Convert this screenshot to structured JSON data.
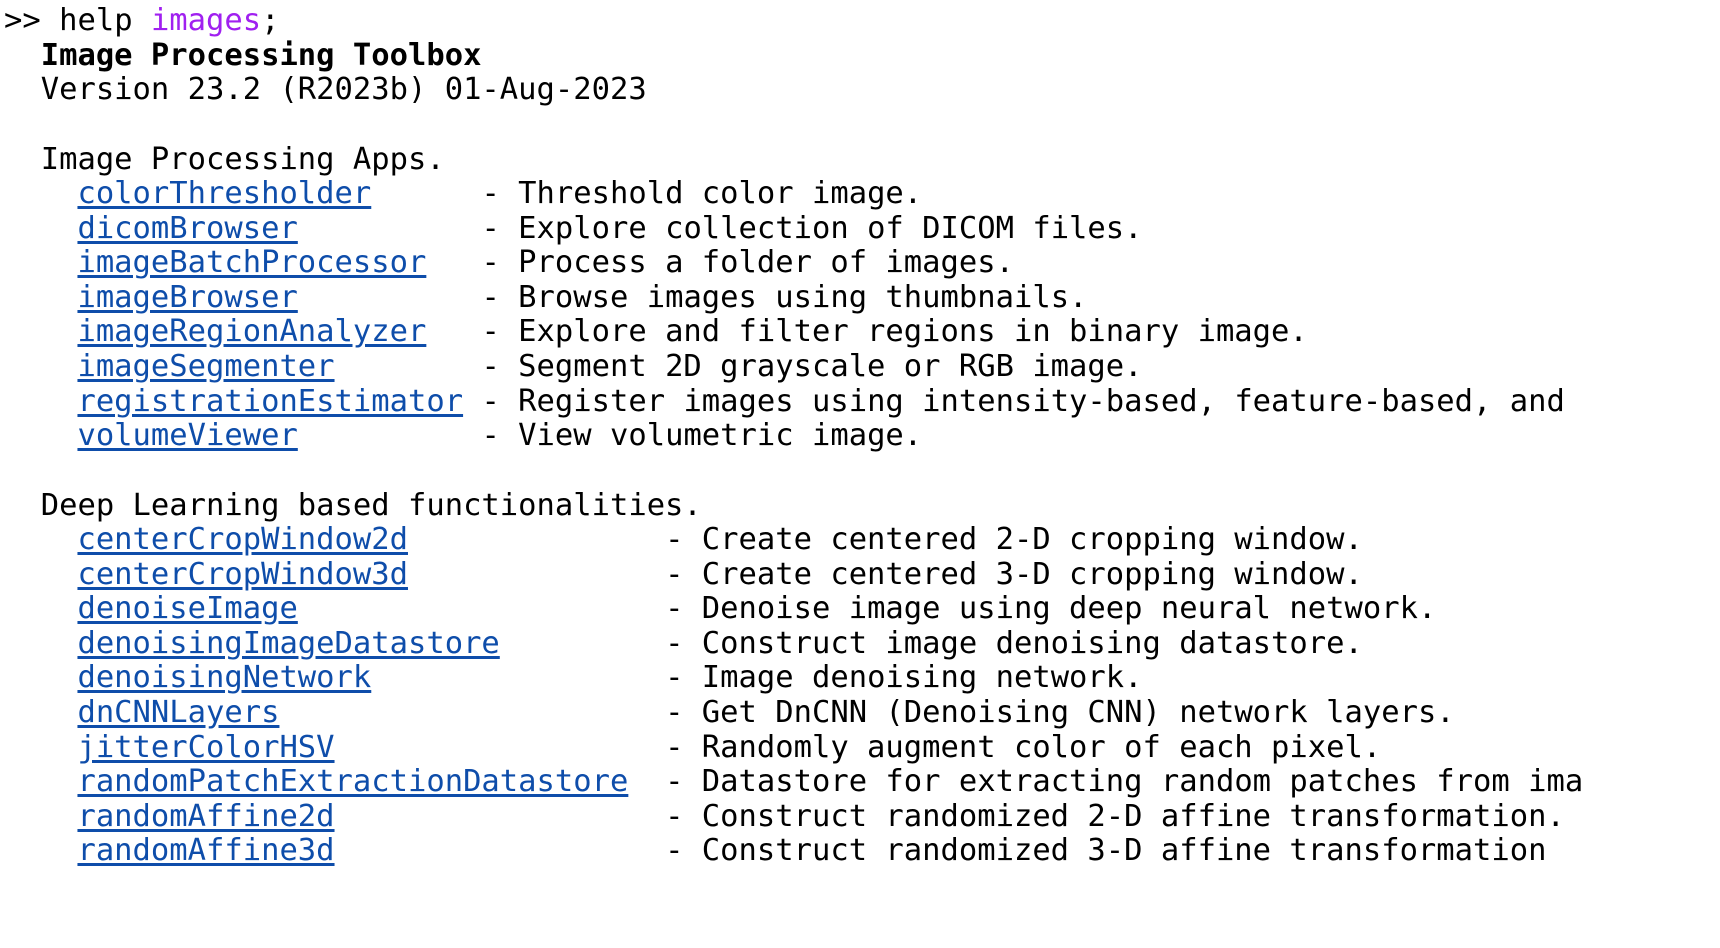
{
  "command": {
    "prompt": ">>",
    "verb": "help",
    "argument": "images",
    "terminator": ";"
  },
  "toolbox": {
    "name": "Image Processing Toolbox",
    "version": "Version 23.2 (R2023b) 01-Aug-2023"
  },
  "sections": [
    {
      "heading": "Image Processing Apps.",
      "items": [
        {
          "name": "colorThresholder",
          "desc": "- Threshold color image."
        },
        {
          "name": "dicomBrowser",
          "desc": "- Explore collection of DICOM files."
        },
        {
          "name": "imageBatchProcessor",
          "desc": "- Process a folder of images."
        },
        {
          "name": "imageBrowser",
          "desc": "- Browse images using thumbnails."
        },
        {
          "name": "imageRegionAnalyzer",
          "desc": "- Explore and filter regions in binary image."
        },
        {
          "name": "imageSegmenter",
          "desc": "- Segment 2D grayscale or RGB image."
        },
        {
          "name": "registrationEstimator",
          "desc": "- Register images using intensity-based, feature-based, and"
        },
        {
          "name": "volumeViewer",
          "desc": "- View volumetric image."
        }
      ]
    },
    {
      "heading": "Deep Learning based functionalities.",
      "items": [
        {
          "name": "centerCropWindow2d",
          "desc": "- Create centered 2-D cropping window."
        },
        {
          "name": "centerCropWindow3d",
          "desc": "- Create centered 3-D cropping window."
        },
        {
          "name": "denoiseImage",
          "desc": "- Denoise image using deep neural network."
        },
        {
          "name": "denoisingImageDatastore",
          "desc": "- Construct image denoising datastore."
        },
        {
          "name": "denoisingNetwork",
          "desc": "- Image denoising network."
        },
        {
          "name": "dnCNNLayers",
          "desc": "- Get DnCNN (Denoising CNN) network layers."
        },
        {
          "name": "jitterColorHSV",
          "desc": "- Randomly augment color of each pixel."
        },
        {
          "name": "randomPatchExtractionDatastore",
          "desc": "- Datastore for extracting random patches from ima"
        },
        {
          "name": "randomAffine2d",
          "desc": "- Construct randomized 2-D affine transformation."
        },
        {
          "name": "randomAffine3d",
          "desc": "- Construct randomized 3-D affine transformation"
        }
      ]
    }
  ],
  "colors": {
    "link": "#0E4DAA",
    "keyword": "#A020F0",
    "text": "#000000",
    "background": "#FFFFFF"
  }
}
